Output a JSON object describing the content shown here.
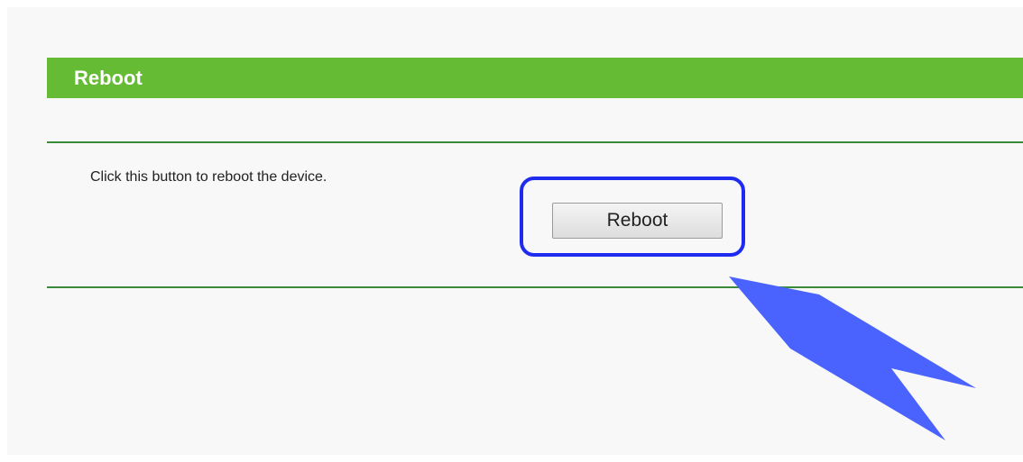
{
  "section": {
    "title": "Reboot",
    "description": "Click this button to reboot the device.",
    "button_label": "Reboot"
  },
  "colors": {
    "header_bg": "#66bb34",
    "divider": "#3a8a3a",
    "highlight_border": "#1f2cf0",
    "arrow_fill": "#4a63ff"
  },
  "annotation": {
    "highlight_icon": "rounded-rectangle-outline",
    "arrow_icon": "pointer-arrow-icon"
  }
}
